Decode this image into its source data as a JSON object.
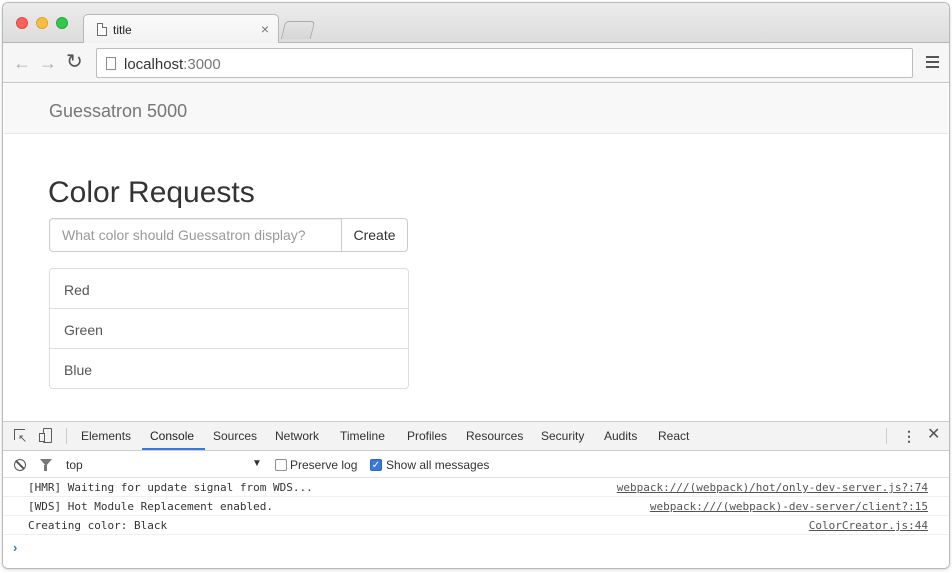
{
  "browser": {
    "tab_title": "title",
    "tab_close": "×",
    "url_host": "localhost",
    "url_port": ":3000"
  },
  "app": {
    "brand": "Guessatron 5000",
    "heading": "Color Requests",
    "input_placeholder": "What color should Guessatron display?",
    "create_label": "Create",
    "colors": [
      "Red",
      "Green",
      "Blue"
    ]
  },
  "devtools": {
    "tabs": [
      "Elements",
      "Console",
      "Sources",
      "Network",
      "Timeline",
      "Profiles",
      "Resources",
      "Security",
      "Audits",
      "React"
    ],
    "active_tab": "Console",
    "context": "top",
    "preserve_log_label": "Preserve log",
    "show_all_label": "Show all messages",
    "preserve_log_checked": false,
    "show_all_checked": true,
    "log": [
      {
        "message": "[HMR] Waiting for update signal from WDS...",
        "source": "webpack:///(webpack)/hot/only-dev-server.js?:74"
      },
      {
        "message": "[WDS] Hot Module Replacement enabled.",
        "source": "webpack:///(webpack)-dev-server/client?:15"
      },
      {
        "message": "Creating color: Black",
        "source": "ColorCreator.js:44"
      }
    ],
    "prompt": "›"
  },
  "colors": {
    "accent": "#3879d9"
  }
}
